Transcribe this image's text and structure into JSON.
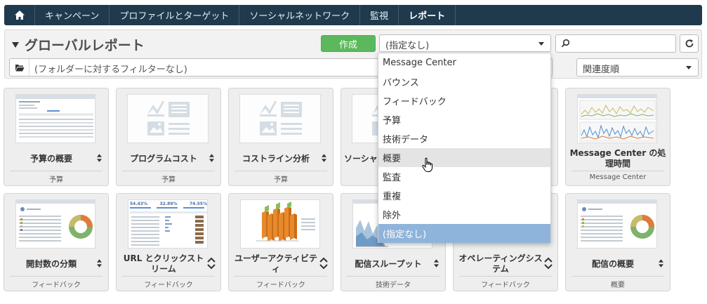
{
  "nav": {
    "home_icon": "home-icon",
    "items": [
      {
        "label": "キャンペーン"
      },
      {
        "label": "プロファイルとターゲット"
      },
      {
        "label": "ソーシャルネットワーク"
      },
      {
        "label": "監視"
      },
      {
        "label": "レポート",
        "active": true
      }
    ]
  },
  "header": {
    "title": "グローバルレポート",
    "create_label": "作成",
    "type_select_value": "(指定なし)",
    "search_value": "",
    "filter_placeholder": "(フォルダーに対するフィルターなし)",
    "sort_value": "関連度順"
  },
  "dropdown": {
    "items": [
      "Message Center",
      "バウンス",
      "フィードバック",
      "予算",
      "技術データ",
      "概要",
      "監査",
      "重複",
      "除外",
      "(指定なし)"
    ],
    "hovered": "概要",
    "selected": "(指定なし)"
  },
  "cards_row1": [
    {
      "title": "予算の概要",
      "category": "予算",
      "thumb": "table-report"
    },
    {
      "title": "プログラムコスト",
      "category": "予算",
      "thumb": "placeholder"
    },
    {
      "title": "コストライン分析",
      "category": "予算",
      "thumb": "placeholder"
    },
    {
      "title": "ソーシャ…獲",
      "category": "",
      "thumb": "placeholder"
    },
    {
      "title": "",
      "category": "",
      "thumb": "hidden"
    },
    {
      "title": "Message Center の処理時間",
      "category": "Message Center",
      "thumb": "line-charts"
    }
  ],
  "cards_row2": [
    {
      "title": "開封数の分類",
      "category": "フィードバック",
      "thumb": "donut-report"
    },
    {
      "title": "URL とクリックストリーム",
      "category": "フィードバック",
      "thumb": "stats-report"
    },
    {
      "title": "ユーザーアクティビティ",
      "category": "フィードバック",
      "thumb": "3d-bars"
    },
    {
      "title": "配信スループット",
      "category": "技術データ",
      "thumb": "area-chart"
    },
    {
      "title": "オペレーティングシステム",
      "category": "フィードバック",
      "thumb": "hidden"
    },
    {
      "title": "配信の概要",
      "category": "概要",
      "thumb": "donut-report"
    }
  ],
  "thumb_texts": {
    "stat1": "54.43%",
    "stat2": "32.89%",
    "stat3": "74.55%"
  },
  "colors": {
    "nav_bg": "#1f3a4d",
    "create_green": "#5cb85c",
    "selected_blue": "#8fb4db",
    "hover_gray": "#e4e4e4"
  }
}
